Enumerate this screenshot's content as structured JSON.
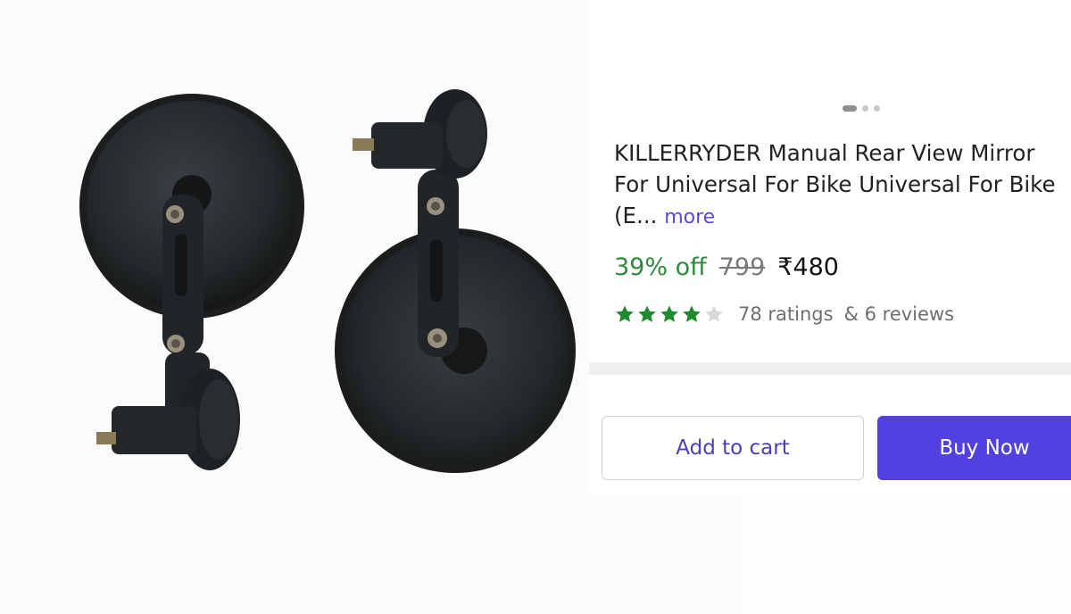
{
  "product": {
    "carousel": {
      "total": 3,
      "active_index": 0
    },
    "title_line_1": "KILLERRYDER Manual Rear View Mirror",
    "title_line_2": "For Universal For Bike Universal For Bike",
    "title_line_3": "(E...",
    "more_label": "more",
    "discount": "39% off",
    "mrp": "799",
    "price": "₹480",
    "rating_stars": 4,
    "ratings_text": "78 ratings",
    "reviews_text": "& 6 reviews"
  },
  "actions": {
    "add_to_cart_label": "Add to cart",
    "buy_now_label": "Buy Now"
  },
  "colors": {
    "discount_green": "#2e8b3d",
    "star_green": "#1f8a2e",
    "accent_purple": "#5240e0",
    "link_purple": "#5b4bd4"
  }
}
